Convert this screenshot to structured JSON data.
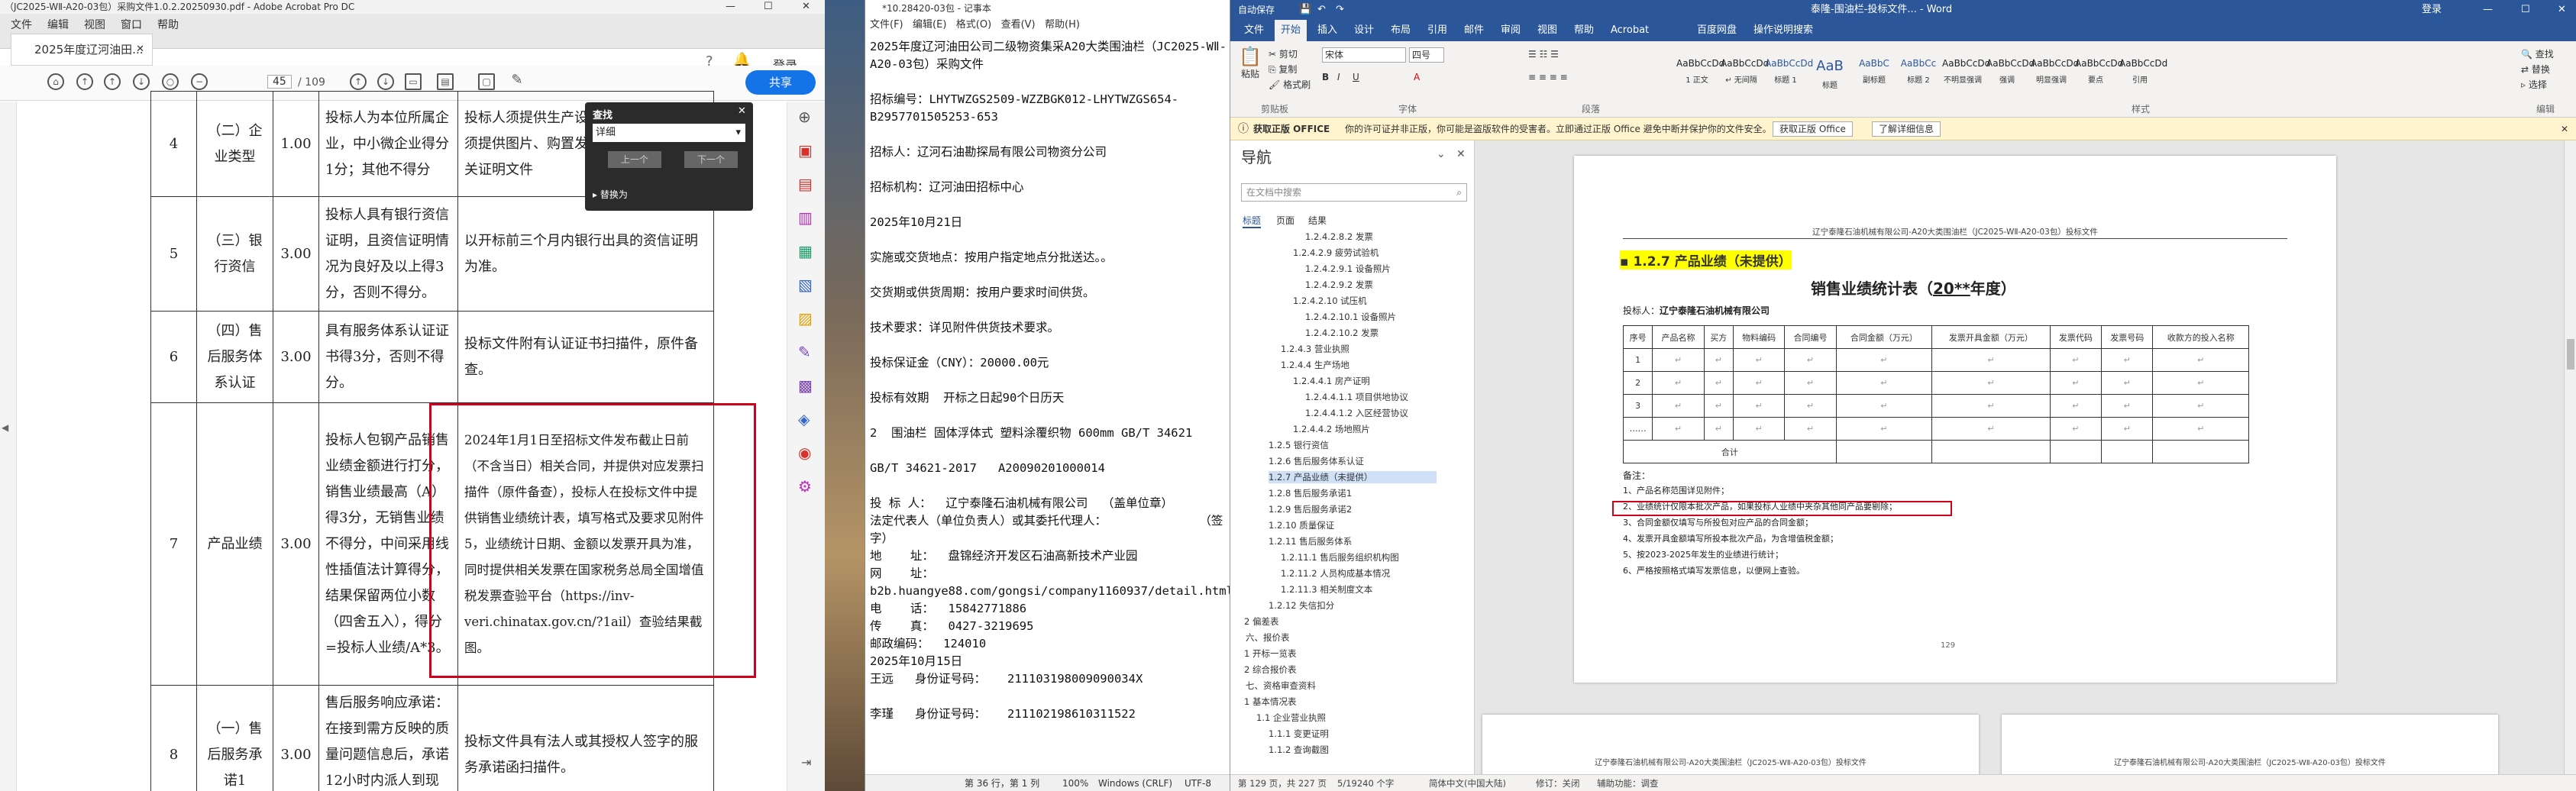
{
  "acrobat": {
    "title": "（JC2025-WⅡ-A20-03包）采购文件1.0.2.20250930.pdf - Adobe Acrobat Pro DC",
    "tab": "2025年度辽河油田...",
    "menu_items": [
      "文件",
      "编辑",
      "视图",
      "窗口",
      "帮助"
    ],
    "signin": "登录",
    "page_current": "45",
    "page_total": "/ 109",
    "share": "共享",
    "find": {
      "title": "查找",
      "value": "详细",
      "prev": "上一个",
      "next": "下一个",
      "replace": "替换为"
    },
    "rows": [
      {
        "no": "4",
        "item": "（二）企业类型",
        "score": "1.00",
        "criteria": "投标人为本位所属企业，中小微企业得分1分；其他不得分",
        "evidence": "投标人须提供生产设备、采购国内设备须提供图片、购置发票；营业执照、相关证明文件"
      },
      {
        "no": "5",
        "item": "（三）银行资信",
        "score": "3.00",
        "criteria": "投标人具有银行资信证明，且资信证明情况为良好及以上得3分，否则不得分。",
        "evidence": "以开标前三个月内银行出具的资信证明为准。"
      },
      {
        "no": "6",
        "item": "（四）售后服务体系认证",
        "score": "3.00",
        "criteria": "具有服务体系认证证书得3分，否则不得分。",
        "evidence": "投标文件附有认证证书扫描件，原件备查。"
      },
      {
        "no": "7",
        "item": "产品业绩",
        "score": "3.00",
        "criteria": "投标人包钢产品销售业绩金额进行打分，销售业绩最高（A）得3分，无销售业绩不得分，中间采用线性插值法计算得分，结果保留两位小数（四舍五入），得分=投标人业绩/A*3。",
        "evidence": "2024年1月1日至招标文件发布截止日前（不含当日）相关合同，并提供对应发票扫描件（原件备查），投标人在投标文件中提供销售业绩统计表，填写格式及要求见附件5，业绩统计日期、金额以发票开具为准，同时提供相关发票在国家税务总局全国增值税发票查验平台（https://inv-veri.chinatax.gov.cn/?1ail）查验结果截图。"
      },
      {
        "no": "8",
        "item": "（一）售后服务承诺1",
        "score": "3.00",
        "criteria": "售后服务响应承诺：在接到需方反映的质量问题信息后，承诺12小时内派人到现场",
        "evidence": "投标文件具有法人或其授权人签字的服务承诺函扫描件。"
      }
    ]
  },
  "notepad": {
    "title": "*10.28420-03包 - 记事本",
    "menu": [
      "文件(F)",
      "编辑(E)",
      "格式(O)",
      "查看(V)",
      "帮助(H)"
    ],
    "lines": [
      "2025年度辽河油田公司二级物资集采A20大类围油栏（JC2025-WⅡ-A20-03包）采购文件",
      "",
      "招标编号：LHYTWZGS2509-WZZBGK012-LHYTWZGS654-B2957701505253-653",
      "",
      "招标人：辽河石油勘探局有限公司物资分公司",
      "",
      "招标机构：辽河油田招标中心",
      "",
      "2025年10月21日",
      "",
      "实施或交货地点：按用户指定地点分批送达。。",
      "",
      "交货期或供货周期：按用户要求时间供货。",
      "",
      "技术要求：详见附件供货技术要求。",
      "",
      "投标保证金（CNY）：20000.00元",
      "",
      "投标有效期  开标之日起90个日历天",
      "",
      "2  围油栏 固体浮体式 塑料涂覆织物 600mm GB/T 34621",
      "",
      "GB/T 34621-2017   A20090201000014",
      "",
      "投 标 人：  辽宁泰隆石油机械有限公司  （盖单位章）",
      "法定代表人（单位负责人）或其委托代理人：             （签字）",
      "地    址：  盘锦经济开发区石油高新技术产业园",
      "网    址：",
      "b2b.huangye88.com/gongsi/company1160937/detail.html",
      "电    话：  15842771886",
      "传    真：  0427-3219695",
      "邮政编码：  124010",
      "2025年10月15日",
      "王远   身份证号码：   211103198009090034X",
      "",
      "李瑾   身份证号码：   211102198610311522"
    ],
    "status": {
      "pos": "第 36 行，第 1 列",
      "zoom": "100%",
      "eol": "Windows (CRLF)",
      "enc": "UTF-8"
    }
  },
  "word": {
    "title": "泰隆-围油栏-投标文件... - Word",
    "autosave": "自动保存",
    "user": "登录",
    "share": "共享",
    "tabs": [
      "文件",
      "开始",
      "插入",
      "设计",
      "布局",
      "引用",
      "邮件",
      "审阅",
      "视图",
      "帮助",
      "Acrobat",
      "百度网盘",
      "操作说明搜索"
    ],
    "clipboard": {
      "cut": "剪切",
      "copy": "复制",
      "paste": "粘贴",
      "painter": "格式刷",
      "group": "剪贴板"
    },
    "font": {
      "name": "宋体",
      "size": "四号",
      "group": "字体"
    },
    "paragraph_group": "段落",
    "styles_group": "样式",
    "editing_group": "编辑",
    "styles": [
      "AaBbCcDd",
      "AaBbCcDd",
      "AaBbCcDd",
      "AaB",
      "AaBbC",
      "AaBbCc",
      "AaBbCcDd",
      "AaBbCcDd",
      "AaBbCcDd",
      "AaBbCcDd",
      "AaBbCcDd"
    ],
    "style_names": [
      "1 正文",
      "↵ 无间隔",
      "标题 1",
      "标题",
      "副标题",
      "标题 2",
      "不明显强调",
      "强调",
      "明显强调",
      "要点",
      "引用"
    ],
    "editing": [
      "查找",
      "替换",
      "选择"
    ],
    "msg": {
      "title": "获取正版 OFFICE",
      "body": "你的许可证并非正版，你可能是盗版软件的受害者。立即通过正版 Office 避免中断并保护你的文件安全。",
      "btn1": "获取正版 Office",
      "btn2": "了解详细信息"
    },
    "nav": {
      "title": "导航",
      "search": "在文档中搜索",
      "tabs": [
        "标题",
        "页面",
        "结果"
      ],
      "items": [
        "1.2.4.2.8.2 发票",
        "1.2.4.2.9 疲劳试验机",
        "1.2.4.2.9.1 设备照片",
        "1.2.4.2.9.2 发票",
        "1.2.4.2.10 试压机",
        "1.2.4.2.10.1 设备照片",
        "1.2.4.2.10.2 发票",
        "1.2.4.3 营业执照",
        "1.2.4.4 生产场地",
        "1.2.4.4.1 房产证明",
        "1.2.4.4.1.1 项目供地协议",
        "1.2.4.4.1.2 入区经营协议",
        "1.2.4.4.2 场地照片",
        "1.2.5 银行资信",
        "1.2.6 售后服务体系认证",
        "1.2.7 产品业绩（未提供）",
        "1.2.8 售后服务承诺1",
        "1.2.9 售后服务承诺2",
        "1.2.10 质量保证",
        "1.2.11 售后服务体系",
        "1.2.11.1 售后服务组织机构图",
        "1.2.11.2 人员构成基本情况",
        "1.2.11.3 相关制度文本",
        "1.2.12 失信扣分",
        "2 偏差表",
        "六、报价表",
        "1 开标一览表",
        "2 综合报价表",
        "七、资格审查资料",
        "1 基本情况表",
        "1.1 企业营业执照",
        "1.1.1 变更证明",
        "1.1.2 查询截图"
      ]
    },
    "doc": {
      "header": "辽宁泰隆石油机械有限公司-A20大类围油栏（JC2025-WⅡ-A20-03包）投标文件",
      "heading": "1.2.7 产品业绩（未提供）",
      "table_title_pre": "销售业绩统计表（",
      "table_title_year": "20**",
      "table_title_post": "年度）",
      "bidder_label": "投标人：",
      "bidder": "辽宁泰隆石油机械有限公司",
      "columns": [
        "序号",
        "产品名称",
        "买方",
        "物料编码",
        "合同编号",
        "合同金额（万元）",
        "发票开具金额（万元）",
        "发票代码",
        "发票号码",
        "收款方的投入名称"
      ],
      "rows": [
        "1",
        "2",
        "3",
        "……"
      ],
      "total": "合计",
      "notes_title": "备注：",
      "notes": [
        "1、产品名称范围详见附件；",
        "2、业绩统计仅限本批次产品，如果投标人业绩中夹杂其他同产品要剔除；",
        "3、合同金额仅填写与所投包对应产品的合同金额；",
        "4、发票开具金额填写所投本批次产品，为含增值税金额；",
        "5、按2023-2025年发生的业绩进行统计；",
        "6、严格按照格式填写发票信息，以便网上查验。"
      ],
      "page_num": "129",
      "footer_header": "辽宁泰隆石油机械有限公司-A20大类围油栏（JC2025-WⅡ-A20-03包）投标文件"
    },
    "status": {
      "page": "第 129 页，共 227 页",
      "words": "5/19240 个字",
      "lang": "简体中文(中国大陆)",
      "track": "修订：关闭",
      "access": "辅助功能：调查"
    }
  },
  "colors": {
    "accent": "#2b579a",
    "highlight": "#ffff00",
    "redbox": "#d0021b",
    "adobe_blue": "#1473e6"
  }
}
